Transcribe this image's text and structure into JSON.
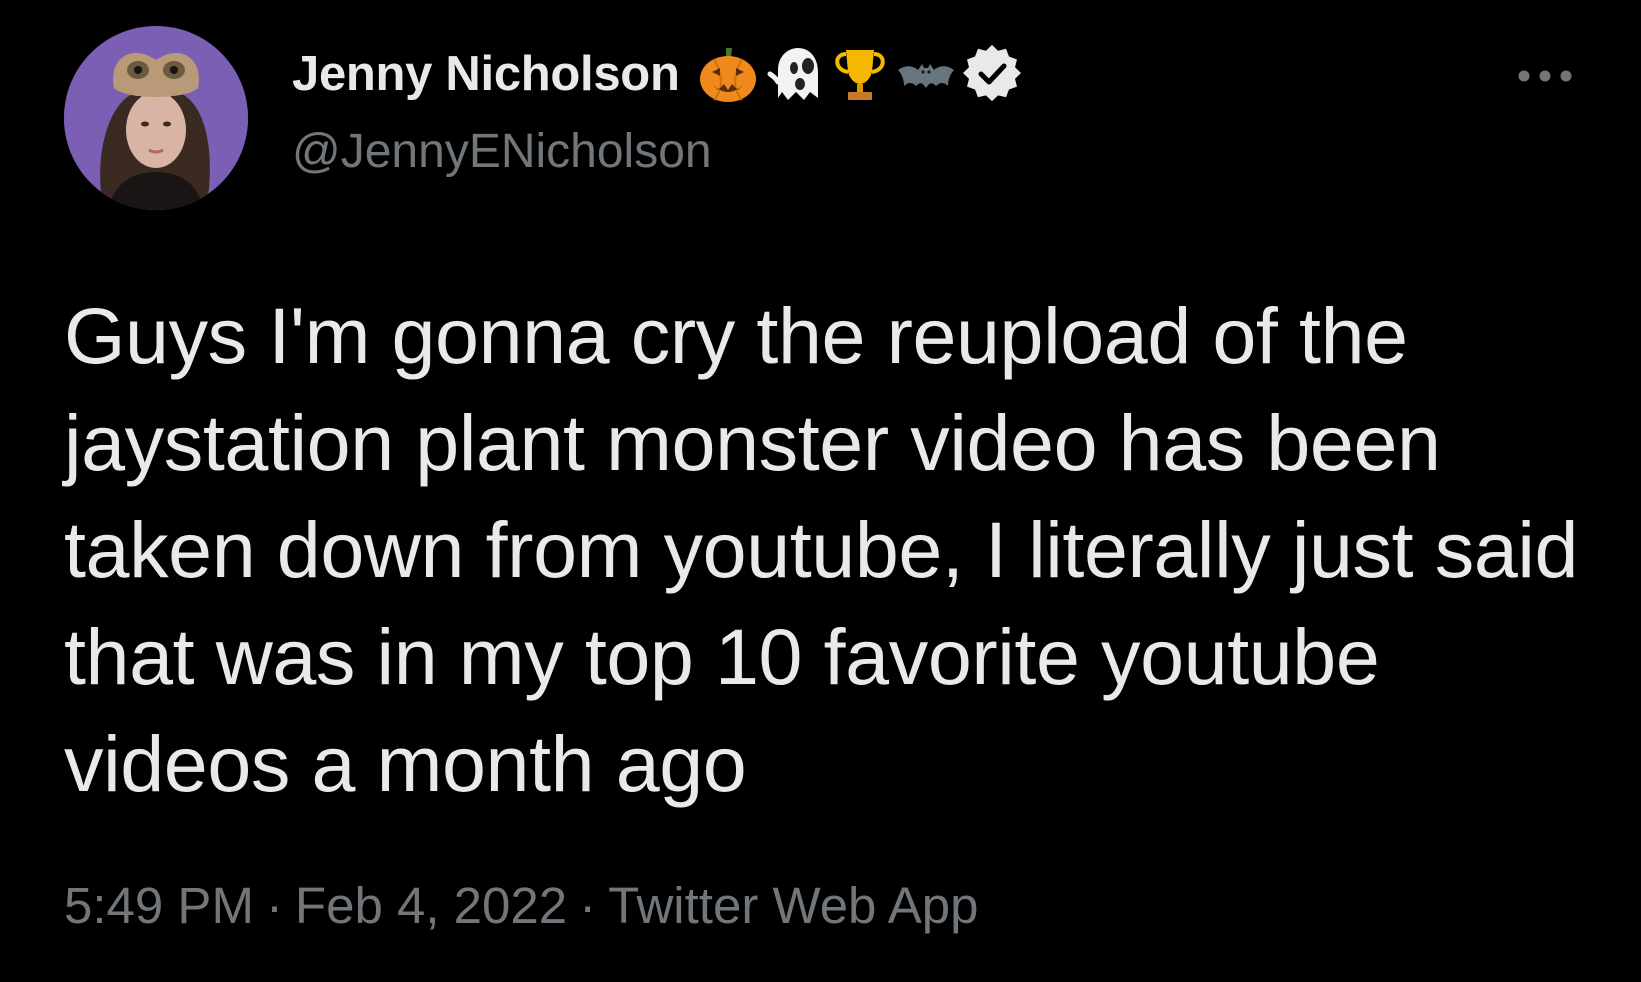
{
  "author": {
    "display_name": "Jenny Nicholson",
    "handle": "@JennyENicholson",
    "name_emoji": [
      "jack-o-lantern-icon",
      "ghost-icon",
      "trophy-icon",
      "bat-icon"
    ],
    "verified": true
  },
  "tweet": {
    "text": "Guys I'm gonna cry the reupload of the jaystation plant monster video has been taken down from youtube, I literally just said that was in my top 10 favorite youtube videos a month ago",
    "time": "5:49 PM",
    "date": "Feb 4, 2022",
    "source": "Twitter Web App",
    "separator": "·"
  },
  "colors": {
    "background": "#000000",
    "primary_text": "#e7e9ea",
    "secondary_text": "#71767b"
  }
}
